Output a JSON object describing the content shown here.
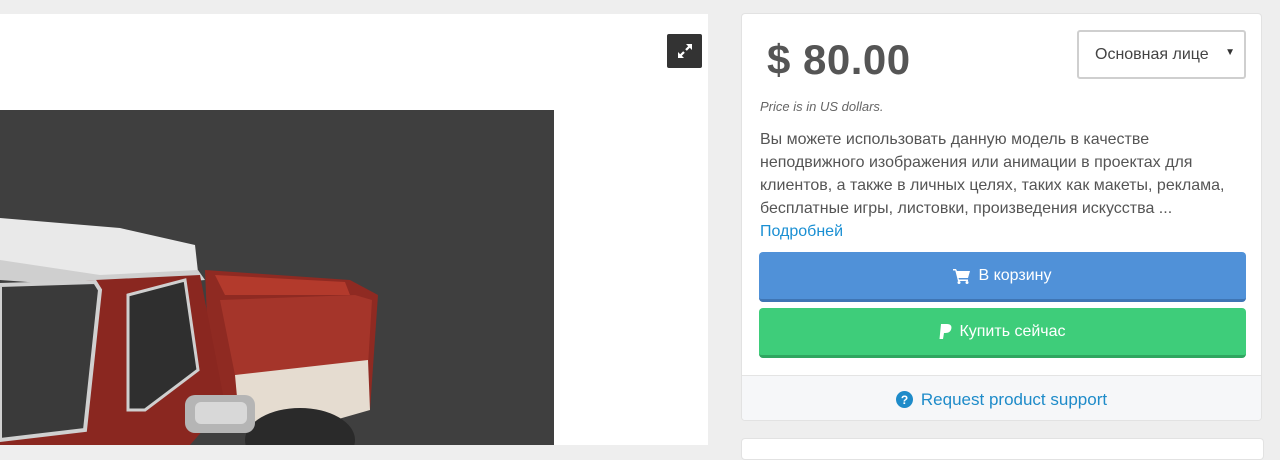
{
  "viewer": {
    "expand_icon": "expand-icon",
    "image_subject": "red-and-white-pickup-truck-3d-model"
  },
  "purchase": {
    "price": "$ 80.00",
    "price_note": "Price is in US dollars.",
    "license_select": {
      "selected": "Основная лице",
      "caret_icon": "caret-down-icon"
    },
    "description": "Вы можете использовать данную модель в качестве неподвижного изображения или анимации в проектах для клиентов, а также в личных целях, таких как макеты, реклама, бесплатные игры, листовки, произведения искусства ...",
    "more_link": "Подробней",
    "add_to_cart": {
      "label": "В корзину",
      "icon": "cart-icon"
    },
    "buy_now": {
      "label": "Купить сейчас",
      "icon": "paypal-icon"
    },
    "support": {
      "label": "Request product support",
      "icon": "question-circle-icon"
    }
  },
  "colors": {
    "cart_button": "#5091d8",
    "buy_button": "#3ecd7a",
    "link": "#1a8fd3",
    "viewer_background": "#3f3f3f"
  }
}
